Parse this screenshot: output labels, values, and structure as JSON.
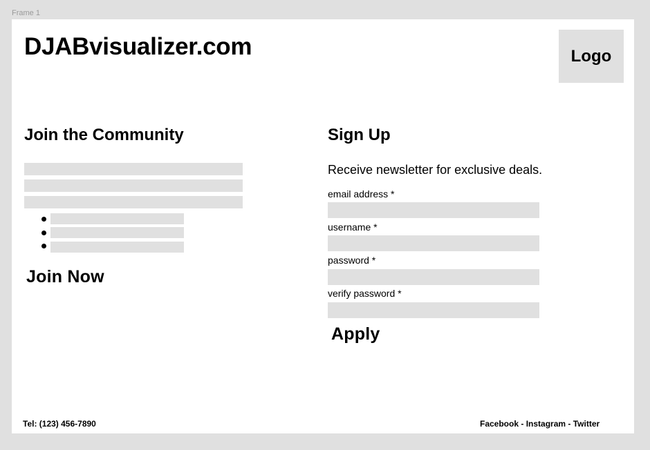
{
  "canvas": {
    "frame_label": "Frame 1"
  },
  "header": {
    "site_title": "DJABvisualizer.com",
    "logo_label": "Logo"
  },
  "community": {
    "heading": "Join the Community",
    "cta_label": "Join Now"
  },
  "signup": {
    "heading": "Sign Up",
    "description": "Receive newsletter for exclusive deals.",
    "fields": [
      {
        "label": "email address *",
        "value": ""
      },
      {
        "label": "username *",
        "value": ""
      },
      {
        "label": "password *",
        "value": ""
      },
      {
        "label": "verify password *",
        "value": ""
      }
    ],
    "submit_label": "Apply"
  },
  "footer": {
    "tel": "Tel: (123) 456-7890",
    "social": [
      "Facebook",
      "Instagram",
      "Twitter"
    ],
    "separator": " - "
  },
  "colors": {
    "page_background": "#e0e0e0",
    "frame_background": "#ffffff",
    "placeholder": "#e0e0e0",
    "text": "#000000",
    "frame_label": "#9a9a9a"
  }
}
